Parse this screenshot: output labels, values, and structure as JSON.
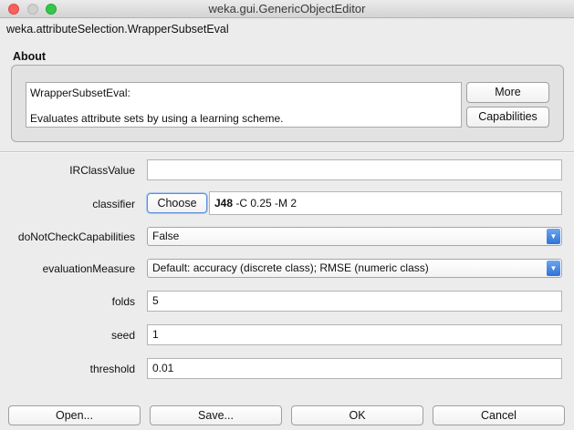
{
  "window": {
    "title": "weka.gui.GenericObjectEditor"
  },
  "class_name": "weka.attributeSelection.WrapperSubsetEval",
  "about": {
    "heading": "About",
    "line1": "WrapperSubsetEval:",
    "line2": "Evaluates attribute sets by using a learning scheme.",
    "more_label": "More",
    "capabilities_label": "Capabilities"
  },
  "properties": {
    "ir_class_value": {
      "label": "IRClassValue",
      "value": ""
    },
    "classifier": {
      "label": "classifier",
      "choose_label": "Choose",
      "name": "J48",
      "options": " -C 0.25 -M 2"
    },
    "do_not_check_capabilities": {
      "label": "doNotCheckCapabilities",
      "value": "False"
    },
    "evaluation_measure": {
      "label": "evaluationMeasure",
      "value": "Default: accuracy (discrete class); RMSE (numeric class)"
    },
    "folds": {
      "label": "folds",
      "value": "5"
    },
    "seed": {
      "label": "seed",
      "value": "1"
    },
    "threshold": {
      "label": "threshold",
      "value": "0.01"
    }
  },
  "buttons": {
    "open": "Open...",
    "save": "Save...",
    "ok": "OK",
    "cancel": "Cancel"
  }
}
